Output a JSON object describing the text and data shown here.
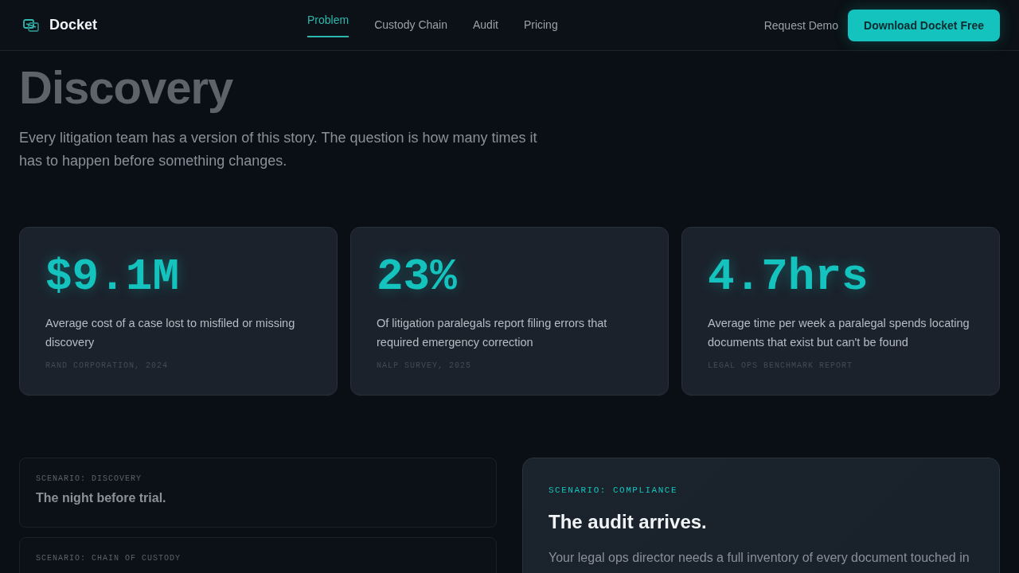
{
  "header": {
    "brand": "Docket",
    "nav": [
      {
        "label": "Problem",
        "selected": true
      },
      {
        "label": "Custody Chain",
        "selected": false
      },
      {
        "label": "Audit",
        "selected": false
      },
      {
        "label": "Pricing",
        "selected": false
      }
    ],
    "secondary_link": "Request Demo",
    "cta": "Download Docket Free"
  },
  "hero": {
    "title_line_2": "Discovery",
    "intro": "Every litigation team has a version of this story. The question is how many times it has to happen before something changes."
  },
  "stats": [
    {
      "value": "$9.1M",
      "description": "Average cost of a case lost to misfiled or missing discovery",
      "source": "RAND CORPORATION, 2024"
    },
    {
      "value": "23%",
      "description": "Of litigation paralegals report filing errors that required emergency correction",
      "source": "NALP SURVEY, 2025"
    },
    {
      "value": "4.7hrs",
      "description": "Average time per week a paralegal spends locating documents that exist but can't be found",
      "source": "LEGAL OPS BENCHMARK REPORT"
    }
  ],
  "scenarios": [
    {
      "label": "SCENARIO: DISCOVERY",
      "title": "The night before trial.",
      "selected": false
    },
    {
      "label": "SCENARIO: CHAIN OF CUSTODY",
      "selected": false
    }
  ],
  "featured_scenario": {
    "label": "SCENARIO: COMPLIANCE",
    "title": "The audit arrives.",
    "text": "Your legal ops director needs a full inventory of every document touched in"
  }
}
